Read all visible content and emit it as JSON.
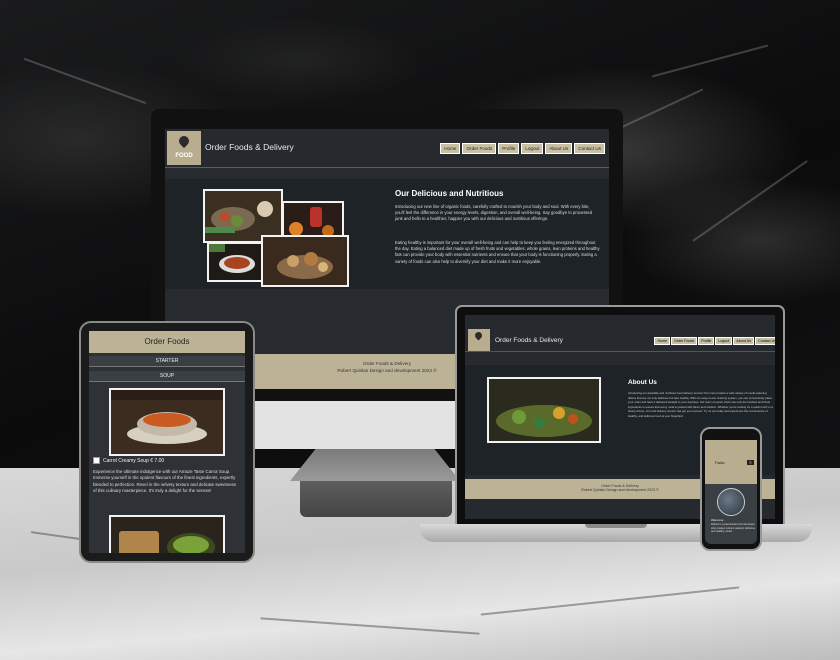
{
  "site": {
    "brand": "Order Foods & Delivery",
    "logo_text": "FOOD",
    "nav": [
      "Home",
      "Order Foods",
      "Profile",
      "Logout",
      "About Us",
      "Contact Us"
    ]
  },
  "desktop": {
    "heading": "Our Delicious and Nutritious",
    "para1": "Introducing our new line of organic foods, carefully crafted to nourish your body and soul. With every bite, you'll feel the difference in your energy levels, digestion, and overall well-being. Say goodbye to processed junk and hello to a healthier, happier you with our delicious and nutritious offerings.",
    "para2": "Eating healthy is important for your overall well-being and can help to keep you feeling energized throughout the day. Eating a balanced diet made up of fresh fruits and vegetables, whole grains, lean proteins and healthy fats can provide your body with essential nutrients and ensure that your body is functioning properly. Eating a variety of foods can also help to diversify your diet and make it more enjoyable.",
    "footer_line1": "Order Foods & Delivery",
    "footer_line2": "Robert Quinlan Design and development 2023 ©"
  },
  "laptop": {
    "heading": "About Us",
    "para": "Introducing our desirable and nutritious food delivery service! Our menu boasts a wide variety of mouth-watering dishes that are not only delicious but also healthy. With our easy-to-use ordering system, you can conveniently place your order and have it delivered straight to your doorstep. Our team of expert chefs use only the freshest and finest ingredients to ensure that every meal is packed with flavor and nutrition. Whether you're looking for a quick lunch or a hearty dinner, our food delivery service has got you covered. Try us out today and experience the convenience of healthy, and delicious food at your fingertips!",
    "footer_line1": "Order Foods & Delivery",
    "footer_line2": "Robert Quinlan Design and development 2023 ©"
  },
  "tablet": {
    "title": "Order Foods",
    "tab1": "STARTER",
    "tab2": "SOUP",
    "item_label": "Carrot Creamy Soup € 7.00",
    "item_desc": "Experience the ultimate indulgence with our Amaze Taste Carrot Soup. Immerse yourself in the opulent flavours of the finest ingredients, expertly blended to perfection. Revel in the velvety texture and delicate sweetness of this culinary masterpiece. It's truly a delight for the senses!"
  },
  "phone": {
    "title": "Fadia",
    "btn": "≡",
    "caption": "Welcome",
    "text": "Robert is a passionate food developer who creates nutrient packed, delicious and healthy meals."
  },
  "colors": {
    "accent": "#bcb397",
    "screen_bg": "#262a2f",
    "content_bg": "#1e2328"
  }
}
